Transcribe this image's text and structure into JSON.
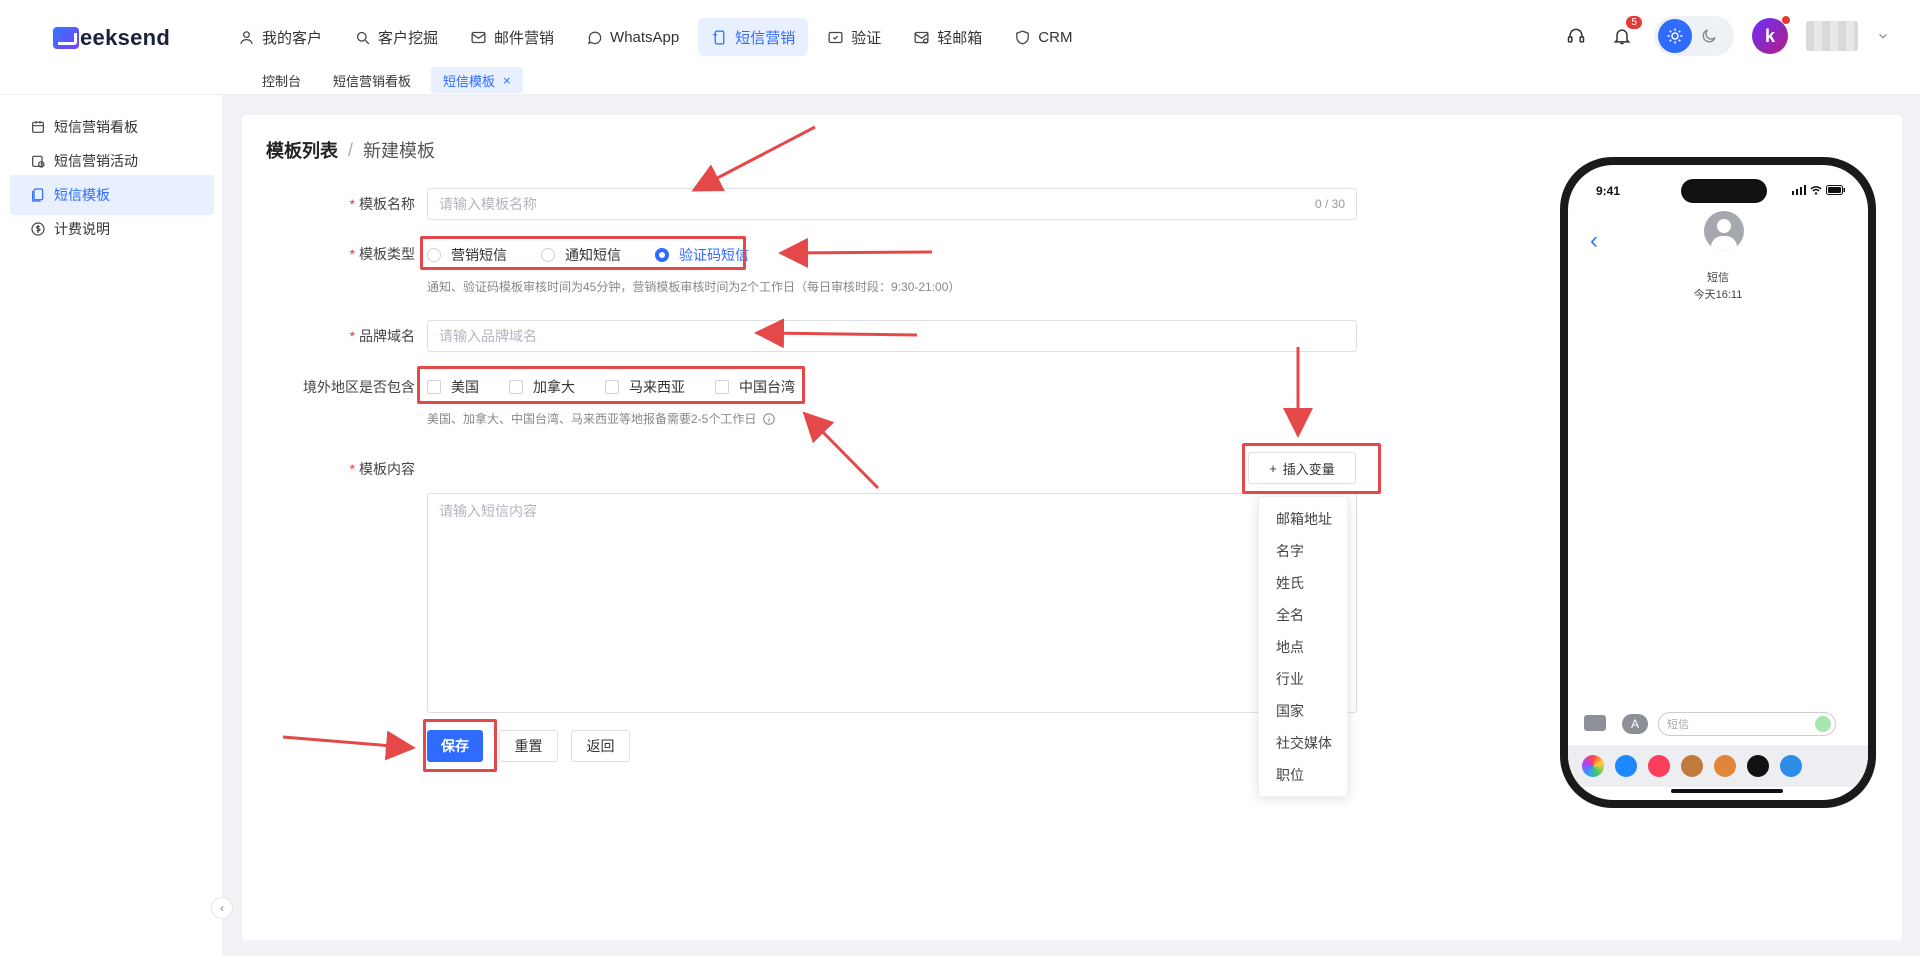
{
  "brand": {
    "logo_text": "eeksend"
  },
  "nav": [
    {
      "label": "我的客户",
      "icon": "user-icon"
    },
    {
      "label": "客户挖掘",
      "icon": "search-icon"
    },
    {
      "label": "邮件营销",
      "icon": "mail-icon"
    },
    {
      "label": "WhatsApp",
      "icon": "whatsapp-icon"
    },
    {
      "label": "短信营销",
      "icon": "sms-icon"
    },
    {
      "label": "验证",
      "icon": "verify-icon"
    },
    {
      "label": "轻邮箱",
      "icon": "light-mail-icon"
    },
    {
      "label": "CRM",
      "icon": "crm-icon"
    }
  ],
  "header": {
    "notification_count": "5",
    "avatar_letter": "k"
  },
  "tabs": [
    {
      "label": "控制台"
    },
    {
      "label": "短信营销看板"
    },
    {
      "label": "短信模板",
      "close": "×"
    }
  ],
  "sidebar": {
    "items": [
      {
        "label": "短信营销看板",
        "icon": "calendar-icon"
      },
      {
        "label": "短信营销活动",
        "icon": "calendar-clock-icon"
      },
      {
        "label": "短信模板",
        "icon": "template-icon"
      },
      {
        "label": "计费说明",
        "icon": "dollar-icon"
      }
    ],
    "collapse_glyph": "‹"
  },
  "breadcrumb": {
    "parent": "模板列表",
    "sep": "/",
    "current": "新建模板"
  },
  "form": {
    "name": {
      "label": "模板名称",
      "placeholder": "请输入模板名称",
      "count": "0 / 30"
    },
    "type": {
      "label": "模板类型",
      "options": [
        "营销短信",
        "通知短信",
        "验证码短信"
      ],
      "selected": "验证码短信",
      "hint": "通知、验证码模板审核时间为45分钟，营销模板审核时间为2个工作日（每日审核时段：9:30-21:00）"
    },
    "brand_domain": {
      "label": "品牌域名",
      "placeholder": "请输入品牌域名"
    },
    "regions": {
      "label": "境外地区是否包含",
      "options": [
        "美国",
        "加拿大",
        "马来西亚",
        "中国台湾"
      ],
      "hint": "美国、加拿大、中国台湾、马来西亚等地报备需要2-5个工作日"
    },
    "content": {
      "label": "模板内容",
      "placeholder": "请输入短信内容"
    },
    "insert_variable": {
      "label": "插入变量"
    },
    "variables": [
      "邮箱地址",
      "名字",
      "姓氏",
      "全名",
      "地点",
      "行业",
      "国家",
      "社交媒体",
      "职位"
    ],
    "buttons": {
      "save": "保存",
      "reset": "重置",
      "back": "返回"
    }
  },
  "phone": {
    "time": "9:41",
    "contact": "短信",
    "when": "今天16:11",
    "input_placeholder": "短信"
  },
  "colors": {
    "accent": "#2f6bff",
    "annotation": "#e44848"
  }
}
